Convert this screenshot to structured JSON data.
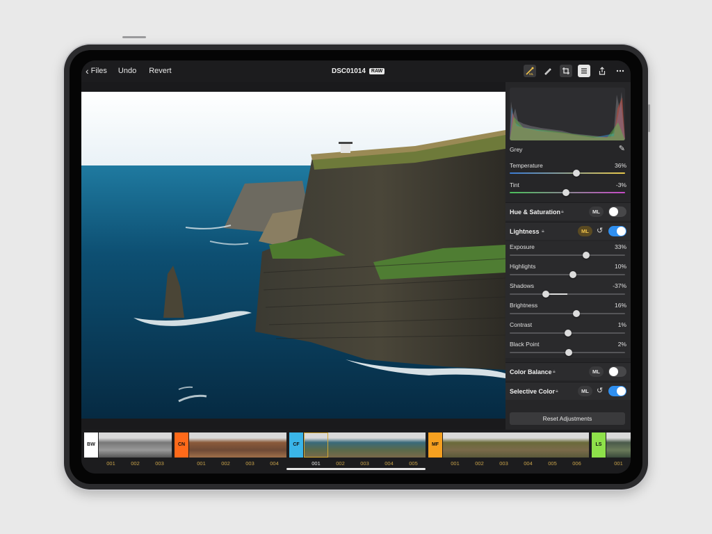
{
  "topbar": {
    "back_label": "Files",
    "undo_label": "Undo",
    "revert_label": "Revert",
    "title": "DSC01014",
    "badge": "RAW",
    "icons": [
      "ml-adjust-icon",
      "brush-icon",
      "crop-icon",
      "adjust-panel-icon",
      "share-icon",
      "more-icon"
    ]
  },
  "panel": {
    "white_balance": {
      "mode": "Grey",
      "temperature": {
        "label": "Temperature",
        "value": "36%"
      },
      "tint": {
        "label": "Tint",
        "value": "-3%"
      }
    },
    "hue_saturation": {
      "title": "Hue & Saturation",
      "ml": "ML",
      "enabled": false
    },
    "lightness": {
      "title": "Lightness",
      "ml": "ML",
      "enabled": true,
      "sliders": [
        {
          "label": "Exposure",
          "value": "33%"
        },
        {
          "label": "Highlights",
          "value": "10%"
        },
        {
          "label": "Shadows",
          "value": "-37%"
        },
        {
          "label": "Brightness",
          "value": "16%"
        },
        {
          "label": "Contrast",
          "value": "1%"
        },
        {
          "label": "Black Point",
          "value": "2%"
        }
      ]
    },
    "color_balance": {
      "title": "Color Balance",
      "ml": "ML",
      "enabled": false
    },
    "selective_color": {
      "title": "Selective Color",
      "ml": "ML",
      "enabled": true
    },
    "reset_label": "Reset Adjustments"
  },
  "filmstrip": {
    "groups": [
      {
        "tag": "BW",
        "color": "#ffffff",
        "text_color": "#111111",
        "items": [
          "001",
          "002",
          "003"
        ]
      },
      {
        "tag": "CN",
        "color": "#ff6a1a",
        "text_color": "#111111",
        "items": [
          "001",
          "002",
          "003",
          "004"
        ]
      },
      {
        "tag": "CF",
        "color": "#3ab5e8",
        "text_color": "#111111",
        "items": [
          "001",
          "002",
          "003",
          "004",
          "005"
        ]
      },
      {
        "tag": "MF",
        "color": "#f5a020",
        "text_color": "#111111",
        "items": [
          "001",
          "002",
          "003",
          "004",
          "005",
          "006"
        ]
      },
      {
        "tag": "LS",
        "color": "#8ee04a",
        "text_color": "#111111",
        "items": [
          "001"
        ]
      }
    ],
    "selected": "CF-001"
  },
  "colors": {
    "accent_toggle": "#2f8ff0",
    "ml_active": "#f0c24a",
    "film_number": "#c8a24a"
  }
}
